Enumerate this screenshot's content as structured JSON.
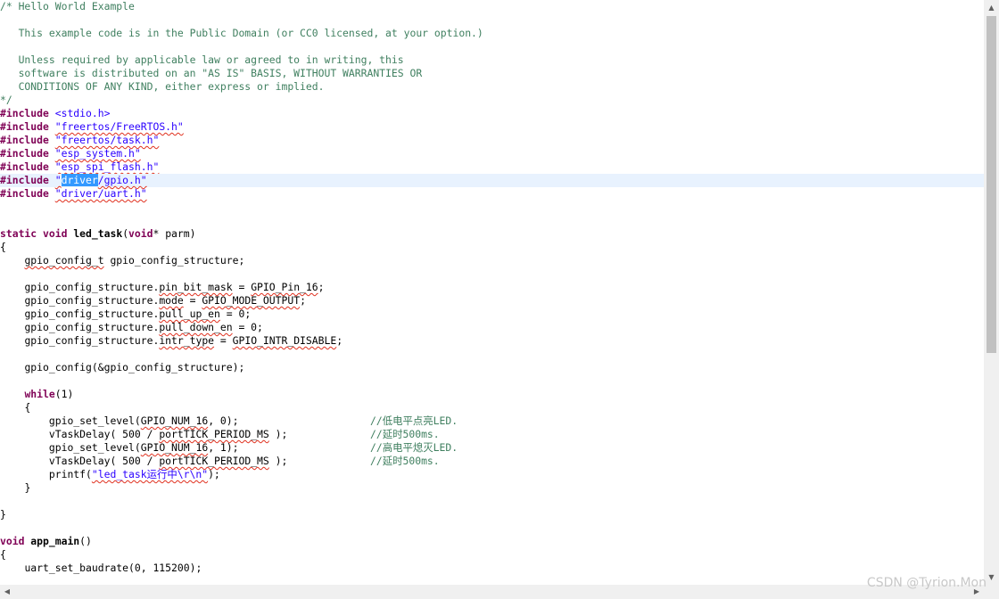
{
  "comment": {
    "l1": "/* Hello World Example",
    "l2": "   This example code is in the Public Domain (or CC0 licensed, at your option.)",
    "l3": "   Unless required by applicable law or agreed to in writing, this",
    "l4": "   software is distributed on an \"AS IS\" BASIS, WITHOUT WARRANTIES OR",
    "l5": "   CONDITIONS OF ANY KIND, either express or implied.",
    "l6": "*/"
  },
  "kw": {
    "include": "#include",
    "static": "static",
    "void": "void",
    "while": "while"
  },
  "includes": {
    "stdio": " <stdio.h>",
    "freertos": "\"freertos/FreeRTOS.h\"",
    "task": "\"freertos/task.h\"",
    "esp_system": "\"esp_system.h\"",
    "esp_spi_flash": "\"esp_spi_flash.h\"",
    "gpio_q1": "\"",
    "gpio_sel": "driver",
    "gpio_rest": "/gpio.h\"",
    "uart": "\"driver/uart.h\""
  },
  "code": {
    "led_task_name": "led_task",
    "led_task_params": "(",
    "void_star": "void",
    "param_tail": "* parm)",
    "brace_open": "{",
    "brace_close": "}",
    "gpio_config_t": "gpio_config_t",
    "gpio_config_decl": " gpio_config_structure;",
    "struct_prefix": "gpio_config_structure.",
    "pin_bit_mask": "pin_bit_mask",
    "pin_bit_eq": " = ",
    "gpio_pin_16": "GPIO_Pin_16",
    "semi": ";",
    "mode": "mode",
    "gpio_mode_output": "GPIO_MODE_OUTPUT",
    "pull_up_en": "pull_up_en",
    "zero_semi": " = 0;",
    "pull_down_en": "pull_down_en",
    "intr_type": "intr_type",
    "gpio_intr_disable": "GPIO_INTR_DISABLE",
    "gpio_config_call": "gpio_config(&gpio_config_structure);",
    "while_cond": "(1)",
    "set_level_prefix": "gpio_set_level(",
    "gpio_num_16": "GPIO_NUM_16",
    "set_level_0": ", 0);",
    "set_level_1": ", 1);",
    "delay_prefix": "vTaskDelay( 500 / ",
    "port_tick": "portTICK_PERIOD_MS",
    "delay_suffix": " );",
    "comment_low": "//低电平点亮LED.",
    "comment_delay": "//延时500ms.",
    "comment_high": "//高电平熄灭LED.",
    "printf_fn": "printf(",
    "printf_str": "\"led_task运行中\\r\\n\"",
    "printf_tail": ");",
    "app_main_name": "app_main",
    "app_main_params": "()",
    "uart_baud": "uart_set_baudrate(0, 115200);"
  },
  "watermark": "CSDN @Tyrion.Mon",
  "icons": {
    "scroll_up": "▲",
    "scroll_down": "▼",
    "scroll_left": "◀",
    "scroll_right": "▶"
  },
  "colors": {
    "comment": "#3f7f5f",
    "keyword": "#7f0055",
    "string": "#2a00ff",
    "selection": "#3399ff",
    "current_line": "#e8f2fe"
  }
}
